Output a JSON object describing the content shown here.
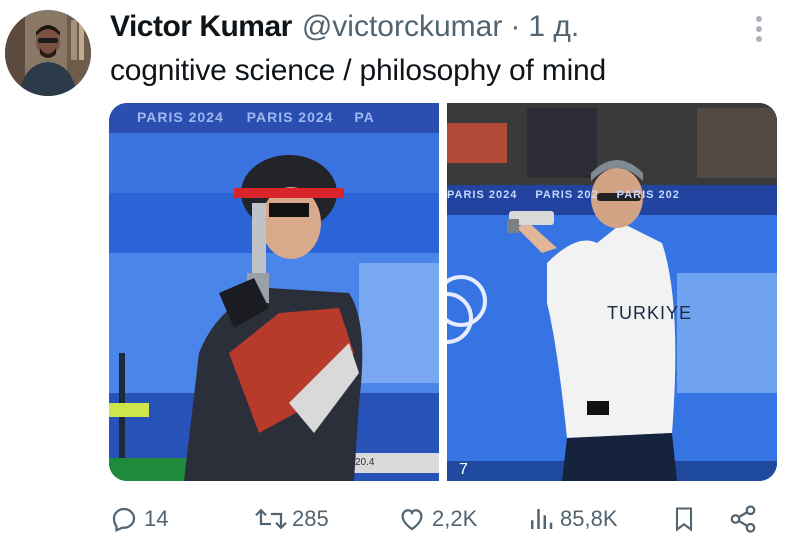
{
  "tweet": {
    "author_name": "Victor Kumar",
    "author_handle": "@victorckumar",
    "separator": "·",
    "time": "1 д.",
    "text": "cognitive science / philosophy of mind"
  },
  "media": {
    "left_banner": "PARIS 2024",
    "left_banner_2": "PARIS 2024",
    "left_banner_3": "PA",
    "left_scoreboard": "20.4",
    "right_banner": "PARIS 2024",
    "right_banner_2": "PARIS 202",
    "right_banner_3": "PARIS 202",
    "right_shirt_text": "TURKIYE",
    "right_number": "7"
  },
  "actions": {
    "replies": "14",
    "retweets": "285",
    "likes": "2,2K",
    "views": "85,8K"
  },
  "colors": {
    "text": "#0f1419",
    "secondary": "#536471",
    "arena_blue": "#2d5fd0"
  }
}
